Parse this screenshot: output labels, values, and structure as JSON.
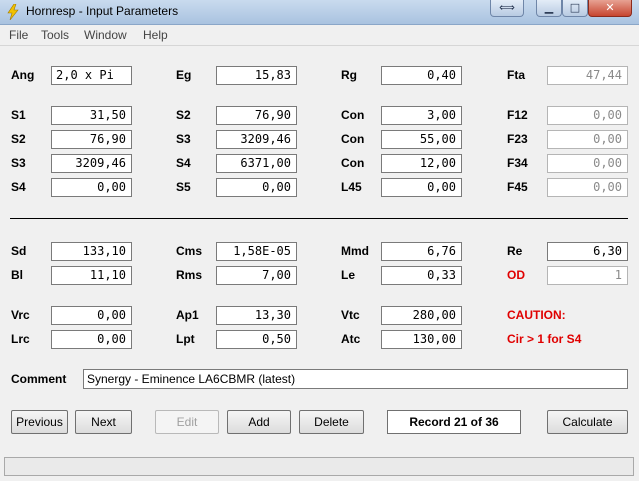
{
  "window": {
    "title": "Hornresp - Input Parameters",
    "swap_icon": "⟺",
    "min_icon": "▁",
    "max_icon": "□",
    "close_icon": "✕"
  },
  "menu": [
    "File",
    "Tools",
    "Window",
    "Help"
  ],
  "labels": {
    "ang": "Ang",
    "eg": "Eg",
    "rg": "Rg",
    "fta": "Fta",
    "s1": "S1",
    "s2b": "S2",
    "con1": "Con",
    "f12": "F12",
    "s2": "S2",
    "s3b": "S3",
    "con2": "Con",
    "f23": "F23",
    "s3": "S3",
    "s4b": "S4",
    "con3": "Con",
    "f34": "F34",
    "s4": "S4",
    "s5": "S5",
    "l45": "L45",
    "f45": "F45",
    "sd": "Sd",
    "cms": "Cms",
    "mmd": "Mmd",
    "re": "Re",
    "bl": "Bl",
    "rms": "Rms",
    "le": "Le",
    "od": "OD",
    "vrc": "Vrc",
    "ap1": "Ap1",
    "vtc": "Vtc",
    "caution": "CAUTION:",
    "lrc": "Lrc",
    "lpt": "Lpt",
    "atc": "Atc",
    "cir_warning": "Cir > 1 for S4",
    "comment": "Comment"
  },
  "values": {
    "ang": "2,0 x Pi",
    "eg": "15,83",
    "rg": "0,40",
    "fta": "47,44",
    "s1": "31,50",
    "s2b": "76,90",
    "con1": "3,00",
    "f12": "0,00",
    "s2": "76,90",
    "s3b": "3209,46",
    "con2": "55,00",
    "f23": "0,00",
    "s3": "3209,46",
    "s4b": "6371,00",
    "con3": "12,00",
    "f34": "0,00",
    "s4": "0,00",
    "s5": "0,00",
    "l45": "0,00",
    "f45": "0,00",
    "sd": "133,10",
    "cms": "1,58E-05",
    "mmd": "6,76",
    "re": "6,30",
    "bl": "11,10",
    "rms": "7,00",
    "le": "0,33",
    "od": "1",
    "vrc": "0,00",
    "ap1": "13,30",
    "vtc": "280,00",
    "lrc": "0,00",
    "lpt": "0,50",
    "atc": "130,00",
    "comment": "Synergy - Eminence LA6CBMR  (latest)"
  },
  "buttons": {
    "previous": "Previous",
    "next": "Next",
    "edit": "Edit",
    "add": "Add",
    "delete": "Delete",
    "record": "Record 21 of 36",
    "calculate": "Calculate"
  },
  "colors": {
    "warning": "#e00000",
    "titlebar": "#b9cfe8"
  }
}
